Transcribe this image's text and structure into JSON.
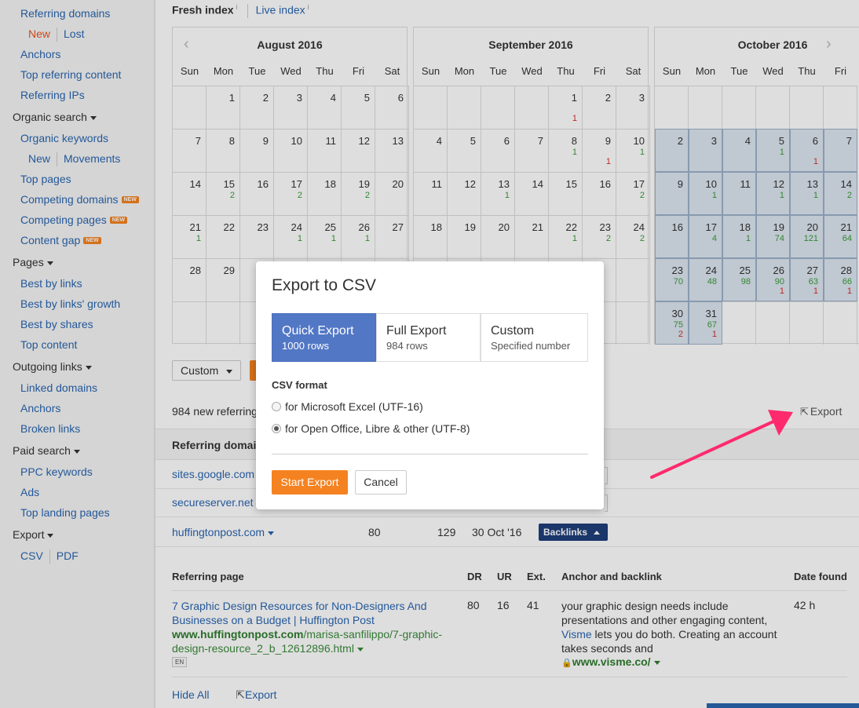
{
  "sidebar": {
    "referring_domains": "Referring domains",
    "new": "New",
    "lost": "Lost",
    "anchors": "Anchors",
    "top_referring_content": "Top referring content",
    "referring_ips": "Referring IPs",
    "organic_search": "Organic search",
    "organic_keywords": "Organic keywords",
    "new2": "New",
    "movements": "Movements",
    "top_pages": "Top pages",
    "competing_domains": "Competing domains",
    "competing_pages": "Competing pages",
    "content_gap": "Content gap",
    "new_badge": "NEW",
    "pages": "Pages",
    "best_by_links": "Best by links",
    "best_by_links_growth": "Best by links' growth",
    "best_by_shares": "Best by shares",
    "top_content": "Top content",
    "outgoing_links": "Outgoing links",
    "linked_domains": "Linked domains",
    "anchors2": "Anchors",
    "broken_links": "Broken links",
    "paid_search": "Paid search",
    "ppc_keywords": "PPC keywords",
    "ads": "Ads",
    "top_landing_pages": "Top landing pages",
    "export": "Export",
    "csv": "CSV",
    "pdf": "PDF"
  },
  "index_tabs": {
    "fresh": "Fresh index",
    "live": "Live index",
    "info": "i"
  },
  "calendars": [
    {
      "title": "August 2016",
      "dow": [
        "Sun",
        "Mon",
        "Tue",
        "Wed",
        "Thu",
        "Fri",
        "Sat"
      ]
    },
    {
      "title": "September 2016",
      "dow": [
        "Sun",
        "Mon",
        "Tue",
        "Wed",
        "Thu",
        "Fri",
        "Sat"
      ]
    },
    {
      "title": "October 2016",
      "dow": [
        "Sun",
        "Mon",
        "Tue",
        "Wed",
        "Thu",
        "Fri"
      ]
    }
  ],
  "calendar_cells": {
    "aug": [
      [
        "",
        "",
        "1",
        "2",
        "3",
        "4",
        "5",
        "6"
      ],
      [
        "7",
        "8",
        "9",
        "10",
        "11",
        "12",
        "13"
      ],
      [
        "14",
        "15",
        "16",
        "17",
        "18",
        "19",
        "20"
      ],
      [
        "21",
        "22",
        "23",
        "24",
        "25",
        "26",
        "27"
      ],
      [
        "28",
        "29"
      ]
    ],
    "aug_green": {
      "15": "2",
      "17": "2",
      "19": "2",
      "21": "1",
      "24": "1",
      "25": "1",
      "26": "1"
    },
    "sep": [
      [
        "",
        "",
        "",
        "",
        "1",
        "2",
        "3"
      ],
      [
        "4",
        "5",
        "6",
        "7",
        "8",
        "9",
        "10"
      ],
      [
        "11",
        "12",
        "13",
        "14",
        "15",
        "16",
        "17"
      ],
      [
        "18",
        "19",
        "20",
        "21",
        "22",
        "23",
        "24"
      ]
    ],
    "sep_green": {
      "8": "1",
      "10": "1",
      "13": "1",
      "17": "2",
      "22": "1",
      "23": "2",
      "24": "2"
    },
    "sep_red": {
      "1": "1",
      "9": "1"
    },
    "sep_partial": {
      "label": "2",
      "green": "2"
    },
    "oct": [
      [
        "2",
        "3",
        "4",
        "5",
        "6",
        "7"
      ],
      [
        "9",
        "10",
        "11",
        "12",
        "13",
        "14"
      ],
      [
        "16",
        "17",
        "18",
        "19",
        "20",
        "21"
      ],
      [
        "23",
        "24",
        "25",
        "26",
        "27",
        "28"
      ],
      [
        "30",
        "31"
      ]
    ],
    "oct_green": {
      "5": "1",
      "10": "1",
      "12": "1",
      "13": "1",
      "14": "2",
      "17": "4",
      "18": "1",
      "19": "74",
      "20": "121",
      "21": "64",
      "23": "70",
      "24": "48",
      "25": "98",
      "26": "90",
      "27": "63",
      "28": "66",
      "30": "75",
      "31": "67"
    },
    "oct_red": {
      "6": "1",
      "26": "1",
      "27": "1",
      "28": "1",
      "30": "2",
      "31": "1"
    }
  },
  "toolbar": {
    "custom": "Custom"
  },
  "results": {
    "count_text": "984 new referring",
    "export": "Export"
  },
  "table": {
    "header": "Referring domain",
    "rows": [
      "sites.google.com",
      "secureserver.net",
      "huffingtonpost.com"
    ],
    "hp_dr": "80",
    "hp_count": "129",
    "hp_date": "30 Oct '16",
    "backlinks_btn": "Backlinks"
  },
  "subtable": {
    "headers": {
      "referring_page": "Referring page",
      "dr": "DR",
      "ur": "UR",
      "ext": "Ext.",
      "anchor": "Anchor and backlink",
      "date": "Date found"
    },
    "title": "7 Graphic Design Resources for Non-Designers And Businesses on a Budget | Huffington Post",
    "url_domain": "www.huffingtonpost.com",
    "url_path": "/marisa-sanfilippo/7-graphic-design-resource_2_b_12612896.html",
    "lang": "EN",
    "dr": "80",
    "ur": "16",
    "ext": "41",
    "anchor_before": "your graphic design needs include presentations and other engaging content, ",
    "anchor_link": "Visme",
    "anchor_after": " lets you do both. Creating an account takes seconds and",
    "anchor_url": "www.visme.co/",
    "date": "42 h"
  },
  "bottom": {
    "hide_all": "Hide All",
    "export": "Export"
  },
  "modal": {
    "title": "Export to CSV",
    "options": [
      {
        "main": "Quick Export",
        "sub": "1000 rows"
      },
      {
        "main": "Full Export",
        "sub": "984 rows"
      },
      {
        "main": "Custom",
        "sub": "Specified number"
      }
    ],
    "csv_format": "CSV format",
    "radio_excel": "for Microsoft Excel (UTF-16)",
    "radio_open": "for Open Office, Libre & other (UTF-8)",
    "start": "Start Export",
    "cancel": "Cancel"
  },
  "colors": {
    "accent": "#f58220",
    "link": "#2a66b0",
    "selected": "#5277c5",
    "arrow": "#ff2a6d"
  }
}
